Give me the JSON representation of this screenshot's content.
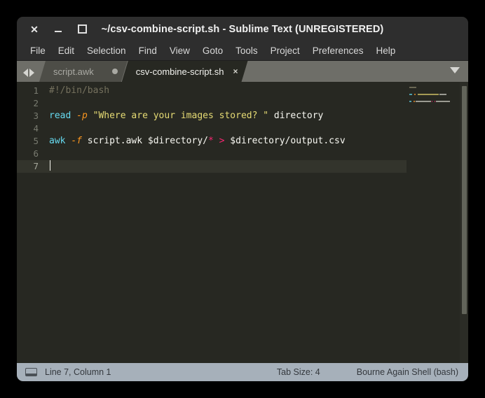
{
  "window": {
    "title": "~/csv-combine-script.sh - Sublime Text (UNREGISTERED)",
    "controls": {
      "close": "×",
      "minimize": "",
      "maximize": ""
    }
  },
  "menubar": {
    "items": [
      {
        "label": "File"
      },
      {
        "label": "Edit"
      },
      {
        "label": "Selection"
      },
      {
        "label": "Find"
      },
      {
        "label": "View"
      },
      {
        "label": "Goto"
      },
      {
        "label": "Tools"
      },
      {
        "label": "Project"
      },
      {
        "label": "Preferences"
      },
      {
        "label": "Help"
      }
    ]
  },
  "tabbar": {
    "tabs": [
      {
        "label": "script.awk",
        "active": false,
        "dirty": true
      },
      {
        "label": "csv-combine-script.sh",
        "active": true,
        "dirty": false,
        "close": "×"
      }
    ]
  },
  "editor": {
    "gutter": [
      "1",
      "2",
      "3",
      "4",
      "5",
      "6",
      "7"
    ],
    "current_line": 7,
    "lines": [
      {
        "number": "1",
        "text": "#!/bin/bash",
        "tokens": [
          {
            "t": "#!/bin/bash",
            "c": "t-comment"
          }
        ]
      },
      {
        "number": "2",
        "text": "",
        "tokens": []
      },
      {
        "number": "3",
        "text": "read -p \"Where are your images stored? \" directory",
        "tokens": [
          {
            "t": "read",
            "c": "t-fn"
          },
          {
            "t": " ",
            "c": "t-plain"
          },
          {
            "t": "-p",
            "c": "t-flag"
          },
          {
            "t": " ",
            "c": "t-plain"
          },
          {
            "t": "\"Where are your images stored? \"",
            "c": "t-str"
          },
          {
            "t": " directory",
            "c": "t-plain"
          }
        ]
      },
      {
        "number": "4",
        "text": "",
        "tokens": []
      },
      {
        "number": "5",
        "text": "awk -f script.awk $directory/* > $directory/output.csv",
        "tokens": [
          {
            "t": "awk",
            "c": "t-fn"
          },
          {
            "t": " ",
            "c": "t-plain"
          },
          {
            "t": "-f",
            "c": "t-flag"
          },
          {
            "t": " script.awk $directory/",
            "c": "t-plain"
          },
          {
            "t": "*",
            "c": "t-op"
          },
          {
            "t": " ",
            "c": "t-plain"
          },
          {
            "t": ">",
            "c": "t-op"
          },
          {
            "t": " $directory/output.csv",
            "c": "t-plain"
          }
        ]
      },
      {
        "number": "6",
        "text": "",
        "tokens": []
      },
      {
        "number": "7",
        "text": "",
        "tokens": [],
        "caret": true
      }
    ]
  },
  "statusbar": {
    "position": "Line 7, Column 1",
    "tab_size": "Tab Size: 4",
    "syntax": "Bourne Again Shell (bash)"
  },
  "colors": {
    "editor_bg": "#272822",
    "comment": "#75715e",
    "function": "#66d9ef",
    "flag": "#fd971f",
    "string": "#e6db74",
    "operator": "#f92672",
    "plain": "#f8f8f2",
    "statusbar_bg": "#a6b0ba",
    "tabbar_bg": "#6e6e68",
    "titlebar_bg": "#2e2e2e"
  }
}
